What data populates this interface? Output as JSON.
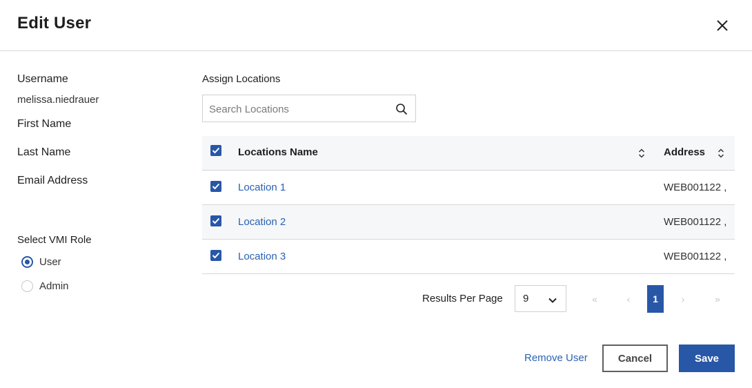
{
  "dialog": {
    "title": "Edit User",
    "close_icon": "close-icon"
  },
  "user": {
    "username_label": "Username",
    "username_value": "melissa.niedrauer",
    "first_name_label": "First Name",
    "last_name_label": "Last Name",
    "email_label": "Email Address"
  },
  "role": {
    "label": "Select VMI Role",
    "options": [
      {
        "label": "User",
        "selected": true
      },
      {
        "label": "Admin",
        "selected": false
      }
    ]
  },
  "locations": {
    "title": "Assign Locations",
    "search_placeholder": "Search Locations",
    "search_value": "",
    "search_icon": "search-icon",
    "columns": {
      "name": "Locations Name",
      "address": "Address"
    },
    "header_checked": true,
    "rows": [
      {
        "name": "Location 1",
        "address": "WEB001122 ,",
        "checked": true
      },
      {
        "name": "Location 2",
        "address": "WEB001122 ,",
        "checked": true
      },
      {
        "name": "Location 3",
        "address": "WEB001122 ,",
        "checked": true
      }
    ]
  },
  "pagination": {
    "results_label": "Results Per Page",
    "per_page": "9",
    "first": "«",
    "prev": "‹",
    "current_page": "1",
    "next": "›",
    "last": "»"
  },
  "actions": {
    "remove_label": "Remove User",
    "cancel_label": "Cancel",
    "save_label": "Save"
  },
  "colors": {
    "accent": "#2857a7",
    "link": "#2a62b0",
    "header_bg": "#f6f7f9"
  }
}
